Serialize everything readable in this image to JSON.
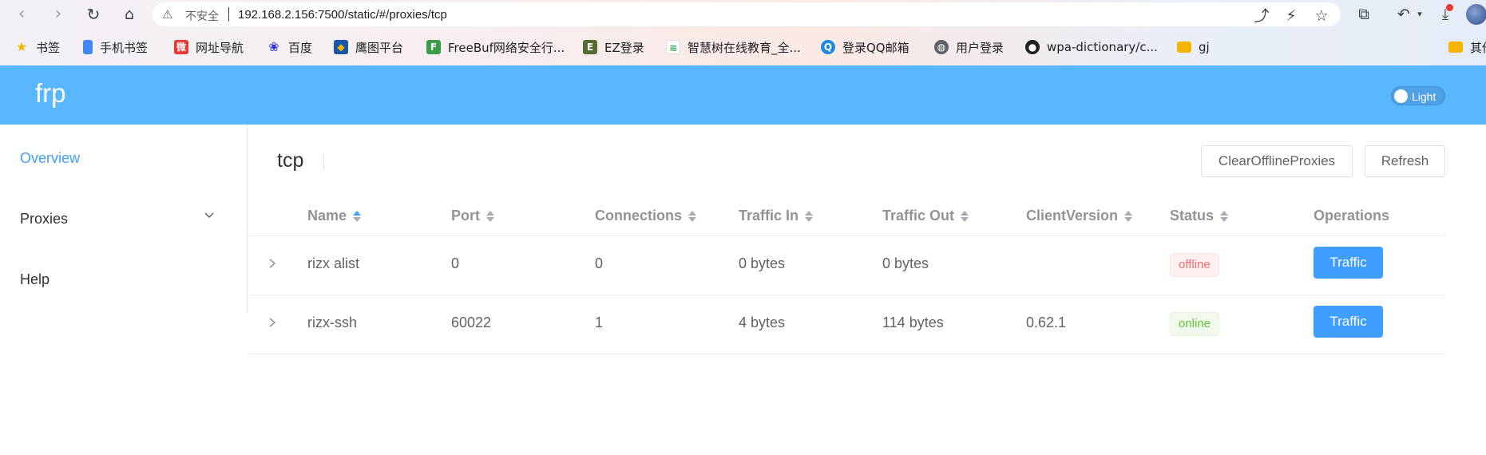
{
  "browser": {
    "security_label": "不安全",
    "url": "192.168.2.156:7500/static/#/proxies/tcp",
    "bookmarks": [
      {
        "label": "书签",
        "icon": "star-icon",
        "color": "#f4b400"
      },
      {
        "label": "手机书签",
        "icon": "phone-icon",
        "color": "#4285f4"
      },
      {
        "label": "网址导航",
        "icon": "weibo-icon",
        "color": "#e53935"
      },
      {
        "label": "百度",
        "icon": "baidu-paw-icon",
        "color": "#2932e1"
      },
      {
        "label": "鹰图平台",
        "icon": "eagle-icon",
        "color": "#1a56a8"
      },
      {
        "label": "FreeBuf网络安全行...",
        "icon": "freebuf-icon",
        "color": "#3a9b48"
      },
      {
        "label": "EZ登录",
        "icon": "ez-icon",
        "color": "#556b2f"
      },
      {
        "label": "智慧树在线教育_全...",
        "icon": "zhihuishu-icon",
        "color": "#2fa84f"
      },
      {
        "label": "登录QQ邮箱",
        "icon": "qqmail-icon",
        "color": "#1e88e5"
      },
      {
        "label": "用户登录",
        "icon": "globe-icon",
        "color": "#5f6368"
      },
      {
        "label": "wpa-dictionary/c...",
        "icon": "github-icon",
        "color": "#202124"
      },
      {
        "label": "gj",
        "icon": "folder-icon",
        "color": "#f4b400"
      },
      {
        "label": "其他",
        "icon": "folder-icon",
        "color": "#f4b400"
      }
    ]
  },
  "app": {
    "brand": "frp",
    "theme_label": "Light"
  },
  "sidebar": {
    "items": [
      {
        "label": "Overview"
      },
      {
        "label": "Proxies"
      },
      {
        "label": "Help"
      }
    ]
  },
  "main": {
    "title": "tcp",
    "clear_button": "ClearOfflineProxies",
    "refresh_button": "Refresh",
    "columns": [
      "Name",
      "Port",
      "Connections",
      "Traffic In",
      "Traffic Out",
      "ClientVersion",
      "Status",
      "Operations"
    ],
    "rows": [
      {
        "name": "rizx alist",
        "port": "0",
        "connections": "0",
        "traffic_in": "0 bytes",
        "traffic_out": "0 bytes",
        "client_version": "",
        "status": "offline",
        "operation": "Traffic"
      },
      {
        "name": "rizx-ssh",
        "port": "60022",
        "connections": "1",
        "traffic_in": "4 bytes",
        "traffic_out": "114 bytes",
        "client_version": "0.62.1",
        "status": "online",
        "operation": "Traffic"
      }
    ]
  },
  "colors": {
    "header": "#58b7ff",
    "primary": "#409eff",
    "offline": "#f56c6c",
    "online": "#67c23a"
  }
}
